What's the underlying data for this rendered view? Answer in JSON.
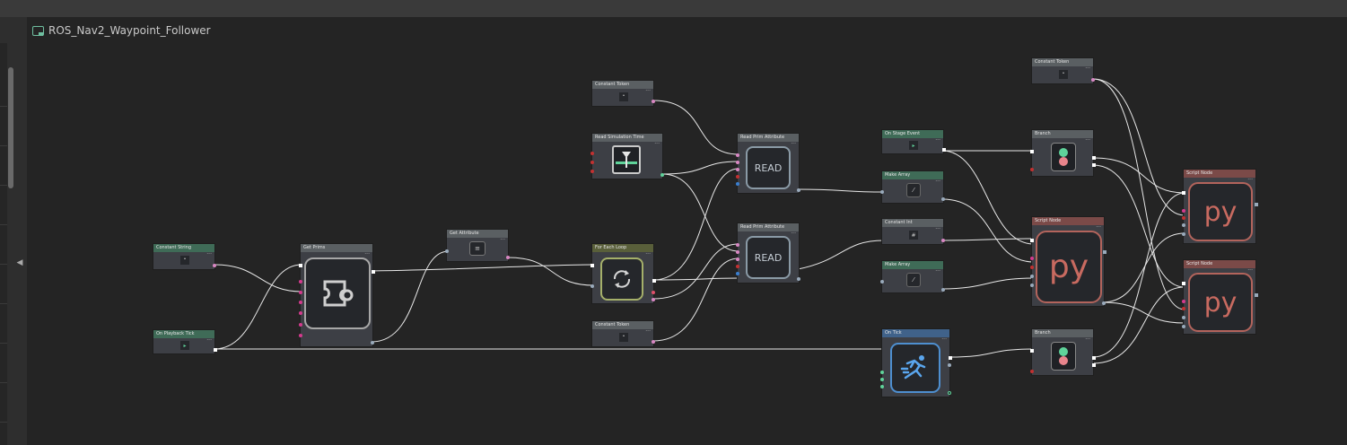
{
  "graph": {
    "title": "ROS_Nav2_Waypoint_Follower",
    "nodes": {
      "const_string": {
        "label": "Constant String"
      },
      "on_playback_tick": {
        "label": "On Playback Tick"
      },
      "get_prims": {
        "label": "Get Prims"
      },
      "get_attribute": {
        "label": "Get Attribute"
      },
      "const_token_1": {
        "label": "Constant Token"
      },
      "read_prim_1": {
        "label": "Read Prim Attribute",
        "icon_text": "READ"
      },
      "read_prim_2": {
        "label": "Read Prim Attribute",
        "icon_text": "READ"
      },
      "read_simulation_time": {
        "label": "Read Simulation Time"
      },
      "for_each_loop": {
        "label": "For Each Loop"
      },
      "const_token_2": {
        "label": "Constant Token"
      },
      "on_stage_event": {
        "label": "On Stage Event"
      },
      "make_array_1": {
        "label": "Make Array"
      },
      "constant_int": {
        "label": "Constant Int"
      },
      "make_array_2": {
        "label": "Make Array"
      },
      "on_tick": {
        "label": "On Tick"
      },
      "constant_token_3": {
        "label": "Constant Token"
      },
      "branch_1": {
        "label": "Branch"
      },
      "branch_2": {
        "label": "Branch"
      },
      "script_node_main": {
        "label": "Script Node",
        "icon_text": "py"
      },
      "script_node_a": {
        "label": "Script Node",
        "icon_text": "py"
      },
      "script_node_b": {
        "label": "Script Node",
        "icon_text": "py"
      }
    }
  },
  "colors": {
    "canvas": "#242424",
    "node_body": "#3d3f45",
    "header_green": "#3f6b57",
    "header_gray": "#5a5f62",
    "header_olive": "#595f3a",
    "header_blue": "#40628a",
    "header_red": "#7b4a48",
    "wire": "#e8e8e8",
    "port_pink": "#d987c3",
    "port_green": "#5fd39a"
  },
  "icons": {
    "title": "graph-icon",
    "get_prims": "prim-gear-icon",
    "loop": "refresh-loop-icon",
    "on_tick": "running-figure-icon",
    "branch": "branch-switch-icon",
    "python": "python-icon"
  }
}
